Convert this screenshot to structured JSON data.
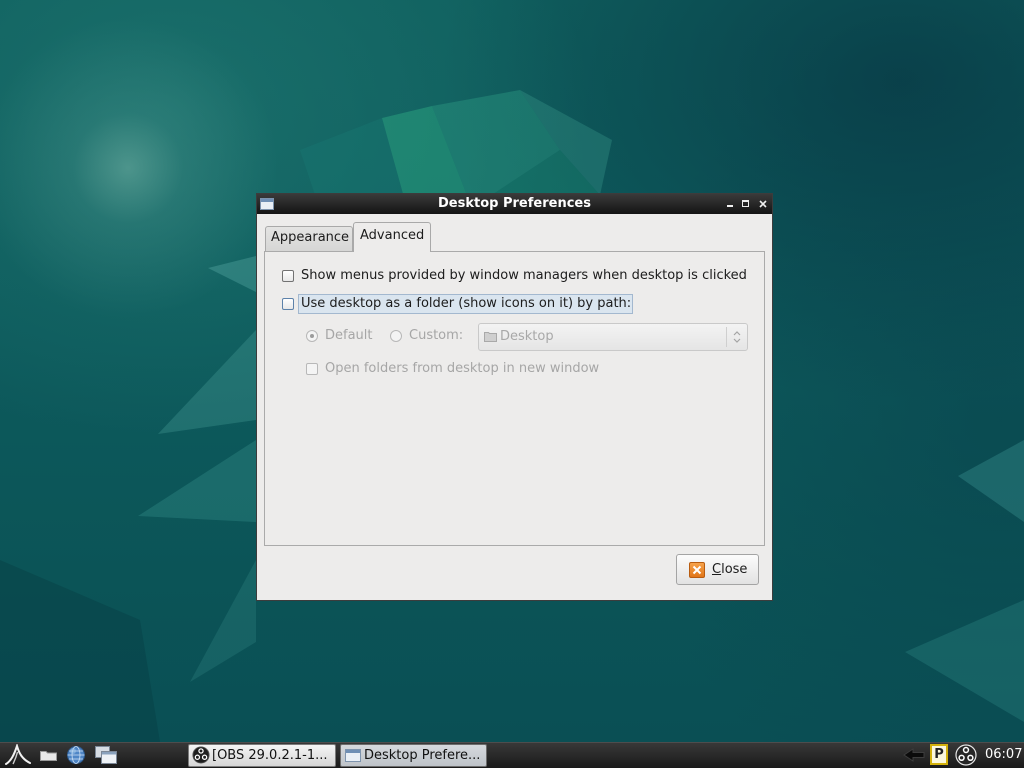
{
  "colors": {
    "desktop_base": "#0c5257",
    "titlebar_top": "#3a3a3a",
    "titlebar_bottom": "#141414",
    "dialog_bg": "#edeceb",
    "focus_highlight": "#dae5ef",
    "disabled_text": "#a6a6a6",
    "taskbar_top": "#383838",
    "taskbar_bottom": "#1a1a1a",
    "close_icon": "#ef8a2c"
  },
  "window": {
    "title": "Desktop Preferences",
    "icon": "window-icon",
    "controls": [
      "minimize-icon",
      "maximize-icon",
      "close-icon"
    ]
  },
  "tabs": [
    {
      "label": "Appearance",
      "active": false
    },
    {
      "label": "Advanced",
      "active": true
    }
  ],
  "advanced": {
    "show_menus": {
      "label": "Show menus provided by window managers when desktop is clicked",
      "checked": false
    },
    "desktop_folder": {
      "label": "Use desktop as a folder (show icons on it) by path:",
      "checked": false,
      "focused": true
    },
    "path_default": {
      "label": "Default",
      "selected": true,
      "enabled": false
    },
    "path_custom": {
      "label": "Custom:",
      "selected": false,
      "enabled": false
    },
    "folder_combo": {
      "value": "Desktop",
      "icon": "folder-icon",
      "enabled": false
    },
    "open_new_window": {
      "label": "Open folders from desktop in new window",
      "checked": false,
      "enabled": false
    }
  },
  "buttons": {
    "close": {
      "label": "Close",
      "icon": "close-dialog-icon"
    }
  },
  "taskbar": {
    "launchers": [
      {
        "icon": "main-menu-icon"
      },
      {
        "icon": "file-manager-icon"
      },
      {
        "icon": "web-browser-icon"
      },
      {
        "icon": "show-desktop-icon"
      }
    ],
    "tasks": [
      {
        "label": "[OBS 29.0.2.1-1...",
        "icon": "obs-icon",
        "active": false
      },
      {
        "label": "Desktop Prefere...",
        "icon": "window-icon",
        "active": true
      }
    ],
    "tray": {
      "icons": [
        "tray-arrow-icon",
        "clipboard-p-icon",
        "obs-tray-icon"
      ],
      "p_letter": "P"
    },
    "clock": "06:07"
  },
  "cursor": {
    "icon": "arrow-cursor-icon"
  }
}
